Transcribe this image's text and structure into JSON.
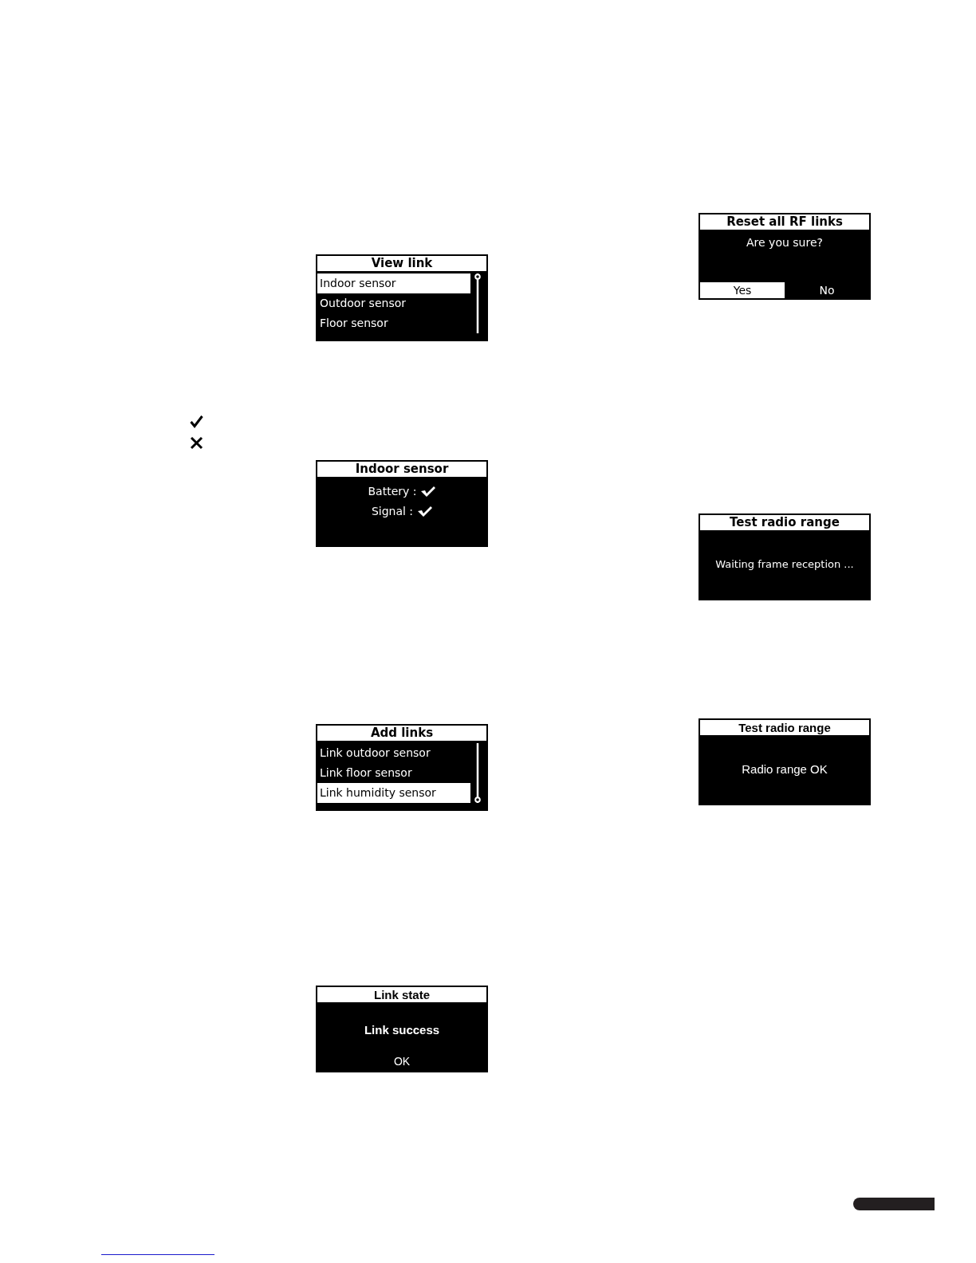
{
  "left_column": [
    {
      "kind": "menu",
      "title": "View link",
      "items": [
        {
          "label": "Indoor sensor",
          "selected": true
        },
        {
          "label": "Outdoor sensor",
          "selected": false
        },
        {
          "label": "Floor sensor",
          "selected": false
        }
      ]
    },
    {
      "kind": "legend",
      "marks": [
        {
          "kind": "tick"
        },
        {
          "kind": "cross"
        }
      ]
    },
    {
      "kind": "status",
      "title": "Indoor sensor",
      "lines": [
        {
          "label": "Battery :",
          "ok": true
        },
        {
          "label": "Signal :",
          "ok": true
        }
      ]
    },
    {
      "kind": "menu",
      "title": "Add links",
      "items": [
        {
          "label": "Link outdoor sensor",
          "selected": false
        },
        {
          "label": "Link floor sensor",
          "selected": false
        },
        {
          "label": "Link humidity sensor",
          "selected": true
        }
      ]
    },
    {
      "kind": "message",
      "title": "Link state",
      "message": "Link success",
      "emphasized": true,
      "button": "OK"
    }
  ],
  "right_column": [
    {
      "kind": "confirm",
      "title": "Reset all RF links",
      "question": "Are you sure?",
      "options": [
        {
          "label": "Yes",
          "selected": true
        },
        {
          "label": "No",
          "selected": false
        }
      ]
    },
    {
      "kind": "waiting",
      "title": "Test radio range",
      "message": "Waiting frame reception ..."
    },
    {
      "kind": "message",
      "title": "Test radio range",
      "message": "Radio range OK",
      "emphasized": false
    }
  ]
}
